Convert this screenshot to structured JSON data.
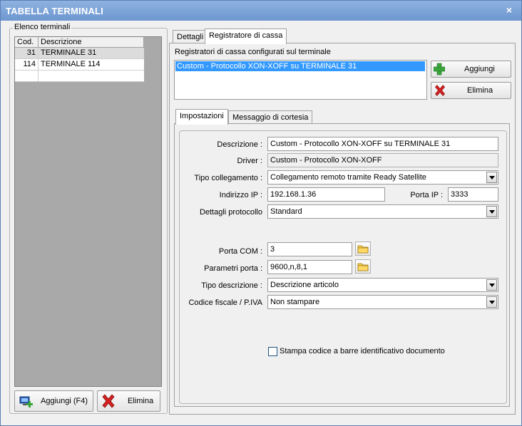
{
  "window": {
    "title": "TABELLA TERMINALI",
    "close_glyph": "×"
  },
  "left": {
    "group_label": "Elenco terminali",
    "columns": [
      "Cod.",
      "Descrizione"
    ],
    "rows": [
      {
        "code": "31",
        "desc": "TERMINALE 31"
      },
      {
        "code": "114",
        "desc": "TERMINALE 114"
      }
    ],
    "add_button": "Aggiungi (F4)",
    "delete_button": "Elimina"
  },
  "tabs": {
    "dettagli": "Dettagli",
    "registratore": "Registratore di cassa"
  },
  "registratore": {
    "list_label": "Registratori di cassa configurati sul terminale",
    "list_items": [
      "Custom - Protocollo XON-XOFF su TERMINALE 31"
    ],
    "add_button": "Aggiungi",
    "delete_button": "Elimina"
  },
  "subtabs": {
    "impostazioni": "Impostazioni",
    "messaggio": "Messaggio di cortesia"
  },
  "form": {
    "descrizione_label": "Descrizione :",
    "descrizione_value": "Custom - Protocollo XON-XOFF su TERMINALE 31",
    "driver_label": "Driver :",
    "driver_value": "Custom - Protocollo XON-XOFF",
    "tipo_collegamento_label": "Tipo collegamento :",
    "tipo_collegamento_value": "Collegamento remoto tramite Ready Satellite",
    "ip_label": "Indirizzo IP :",
    "ip_value": "192.168.1.36",
    "porta_ip_label": "Porta IP :",
    "porta_ip_value": "3333",
    "protocollo_label": "Dettagli protocollo",
    "protocollo_value": "Standard",
    "porta_com_label": "Porta COM :",
    "porta_com_value": "3",
    "parametri_label": "Parametri porta :",
    "parametri_value": "9600,n,8,1",
    "tipo_desc_label": "Tipo descrizione :",
    "tipo_desc_value": "Descrizione articolo",
    "codice_fiscale_label": "Codice fiscale / P.IVA",
    "codice_fiscale_value": "Non stampare",
    "barcode_label": "Stampa codice a barre identificativo documento"
  },
  "colors": {
    "title_bar": "#7aa2d8",
    "selection": "#3399ff",
    "add_green": "#3aa63a",
    "delete_red": "#d42020"
  }
}
